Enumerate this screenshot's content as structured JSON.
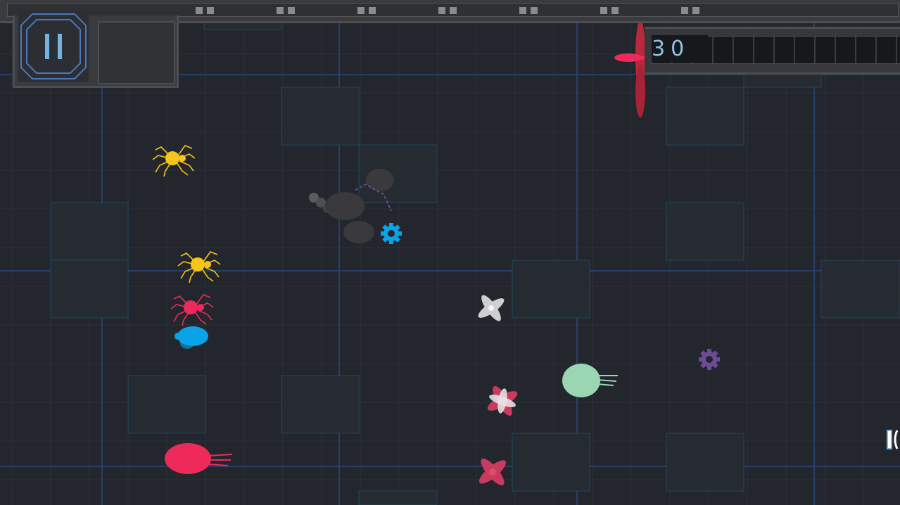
{
  "hud": {
    "score": "30",
    "pause_icon": "pause-icon"
  },
  "colors": {
    "background": "#23262d",
    "grid_line": "#2e3138",
    "grid_major": "#274068",
    "tile_outline": "#1f4a5c",
    "yellow": "#f5c518",
    "pink": "#ee2a5a",
    "blue": "#0aa3e8",
    "mint": "#9ad6b2",
    "purple": "#6e4a99",
    "white_moth": "#d9d9d9",
    "scorpion": "#3a3a3c",
    "pause_frame": "#4a78b8"
  },
  "entities": [
    {
      "name": "yellow-spider",
      "icon": "spider-icon",
      "color": "yellow"
    },
    {
      "name": "yellow-spider",
      "icon": "spider-icon",
      "color": "yellow"
    },
    {
      "name": "pink-spider",
      "icon": "spider-icon",
      "color": "pink"
    },
    {
      "name": "blue-beetle",
      "icon": "beetle-icon",
      "color": "blue"
    },
    {
      "name": "pink-mite",
      "icon": "mite-icon",
      "color": "pink"
    },
    {
      "name": "mint-mite",
      "icon": "mite-icon",
      "color": "mint"
    },
    {
      "name": "scorpion",
      "icon": "scorpion-icon",
      "color": "scorpion"
    },
    {
      "name": "dragonfly",
      "icon": "dragonfly-icon",
      "color": "pink"
    },
    {
      "name": "white-moth",
      "icon": "moth-icon",
      "color": "white_moth"
    },
    {
      "name": "pink-moth",
      "icon": "moth-icon",
      "color": "pink"
    },
    {
      "name": "pink-moth",
      "icon": "moth-icon",
      "color": "pink"
    },
    {
      "name": "blue-gear",
      "icon": "gear-icon",
      "color": "blue"
    },
    {
      "name": "purple-gear",
      "icon": "gear-icon",
      "color": "purple"
    }
  ]
}
